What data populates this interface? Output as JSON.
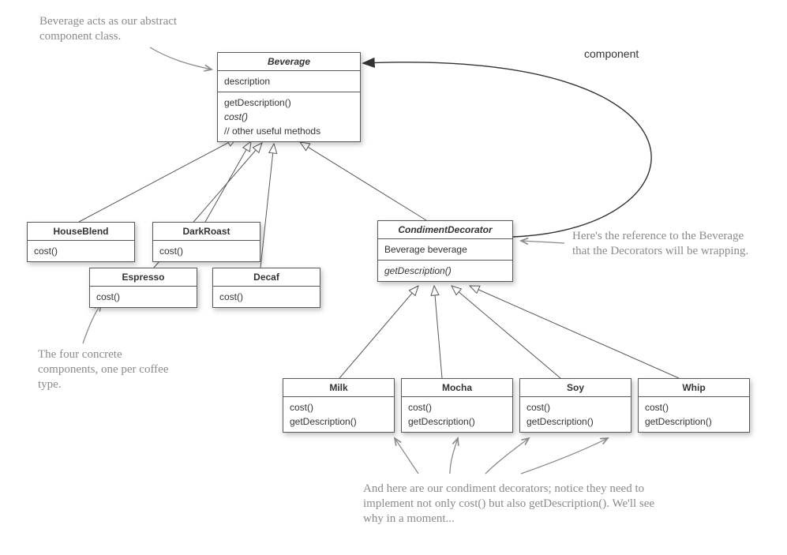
{
  "labels": {
    "component": "component"
  },
  "annotations": {
    "beverage_note": "Beverage acts as our abstract component class.",
    "four_concrete_note": "The four concrete components, one per coffee type.",
    "reference_note": "Here's the reference to the Beverage that the Decorators will be wrapping.",
    "condiment_note": "And here are our condiment decorators; notice they need to implement not only cost() but also getDescription(). We'll see why in a moment..."
  },
  "classes": {
    "beverage": {
      "name": "Beverage",
      "attrs": [
        "description"
      ],
      "methods": [
        "getDescription()",
        "cost()",
        "// other useful methods"
      ],
      "italic_name": true,
      "italic_methods": [
        1
      ]
    },
    "houseblend": {
      "name": "HouseBlend",
      "methods": [
        "cost()"
      ]
    },
    "darkroast": {
      "name": "DarkRoast",
      "methods": [
        "cost()"
      ]
    },
    "espresso": {
      "name": "Espresso",
      "methods": [
        "cost()"
      ]
    },
    "decaf": {
      "name": "Decaf",
      "methods": [
        "cost()"
      ]
    },
    "condiment": {
      "name": "CondimentDecorator",
      "attrs": [
        "Beverage beverage"
      ],
      "methods": [
        "getDescription()"
      ],
      "italic_name": true,
      "italic_methods": [
        0
      ]
    },
    "milk": {
      "name": "Milk",
      "methods": [
        "cost()",
        "getDescription()"
      ]
    },
    "mocha": {
      "name": "Mocha",
      "methods": [
        "cost()",
        "getDescription()"
      ]
    },
    "soy": {
      "name": "Soy",
      "methods": [
        "cost()",
        "getDescription()"
      ]
    },
    "whip": {
      "name": "Whip",
      "methods": [
        "cost()",
        "getDescription()"
      ]
    }
  }
}
